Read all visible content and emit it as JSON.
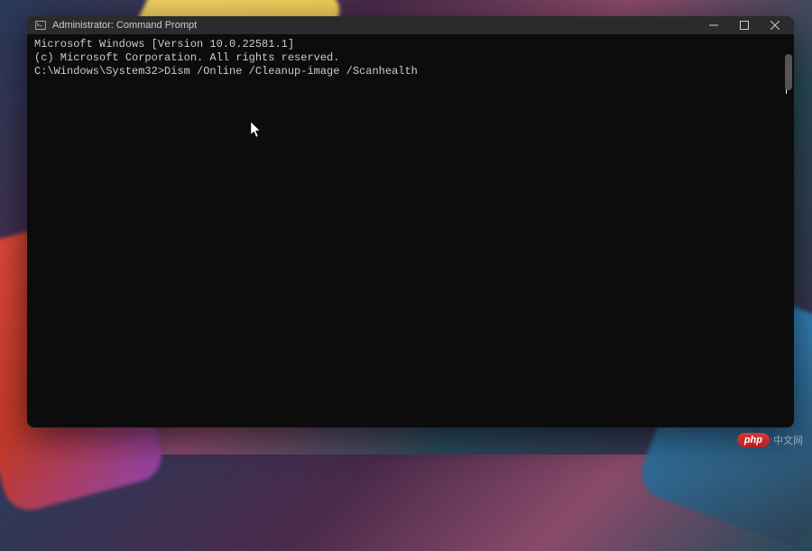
{
  "window": {
    "title": "Administrator: Command Prompt"
  },
  "terminal": {
    "line1": "Microsoft Windows [Version 10.0.22581.1]",
    "line2": "(c) Microsoft Corporation. All rights reserved.",
    "blank": "",
    "prompt_line": "C:\\Windows\\System32>Dism /Online /Cleanup-image /Scanhealth"
  },
  "watermark": {
    "badge": "php",
    "text": "中文网"
  }
}
